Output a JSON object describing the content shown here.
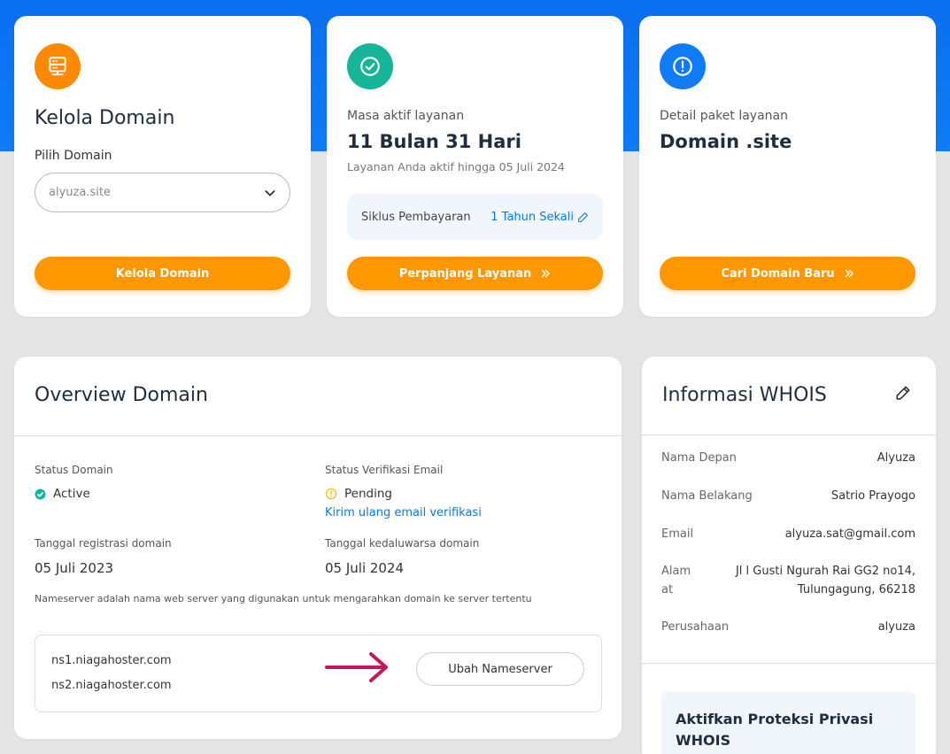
{
  "colors": {
    "brand_blue": "#0f7bf5",
    "orange": "#ff9800",
    "teal": "#16b598",
    "link": "#1176d4",
    "pending": "#f5c518",
    "arrow": "#c2185b"
  },
  "kelola": {
    "icon": "server-icon",
    "title": "Kelola Domain",
    "select_label": "Pilih Domain",
    "select_value": "alyuza.site",
    "button": "Kelola Domain"
  },
  "masa": {
    "icon": "check-circle-icon",
    "label": "Masa aktif layanan",
    "value": "11 Bulan 31 Hari",
    "note": "Layanan Anda aktif hingga 05 Juli 2024",
    "cycle_label": "Siklus Pembayaran",
    "cycle_value": "1 Tahun Sekali",
    "button": "Perpanjang Layanan"
  },
  "paket": {
    "icon": "info-circle-icon",
    "label": "Detail paket layanan",
    "value": "Domain .site",
    "button": "Cari Domain Baru"
  },
  "overview": {
    "title": "Overview Domain",
    "status_label": "Status Domain",
    "status_value": "Active",
    "email_label": "Status Verifikasi Email",
    "email_value": "Pending",
    "resend_link": "Kirim ulang email verifikasi",
    "reg_label": "Tanggal registrasi domain",
    "reg_value": "05 Juli 2023",
    "exp_label": "Tanggal kedaluwarsa domain",
    "exp_value": "05 Juli 2024",
    "ns_note": "Nameserver adalah nama web server yang digunakan untuk mengarahkan domain ke server tertentu",
    "ns1": "ns1.niagahoster.com",
    "ns2": "ns2.niagahoster.com",
    "ns_button": "Ubah Nameserver"
  },
  "whois": {
    "title": "Informasi WHOIS",
    "rows": [
      {
        "label": "Nama Depan",
        "value": "Alyuza"
      },
      {
        "label": "Nama Belakang",
        "value": "Satrio Prayogo"
      },
      {
        "label": "Email",
        "value": "alyuza.sat@gmail.com"
      },
      {
        "label_line1": "Alam",
        "label_line2": "at",
        "value_line1": "Jl l Gusti Ngurah Rai GG2 no14,",
        "value_line2": "Tulungagung, 66218"
      },
      {
        "label": "Perusahaan",
        "value": "alyuza"
      }
    ],
    "privacy_title_line1": "Aktifkan Proteksi Privasi",
    "privacy_title_line2": "WHOIS"
  }
}
